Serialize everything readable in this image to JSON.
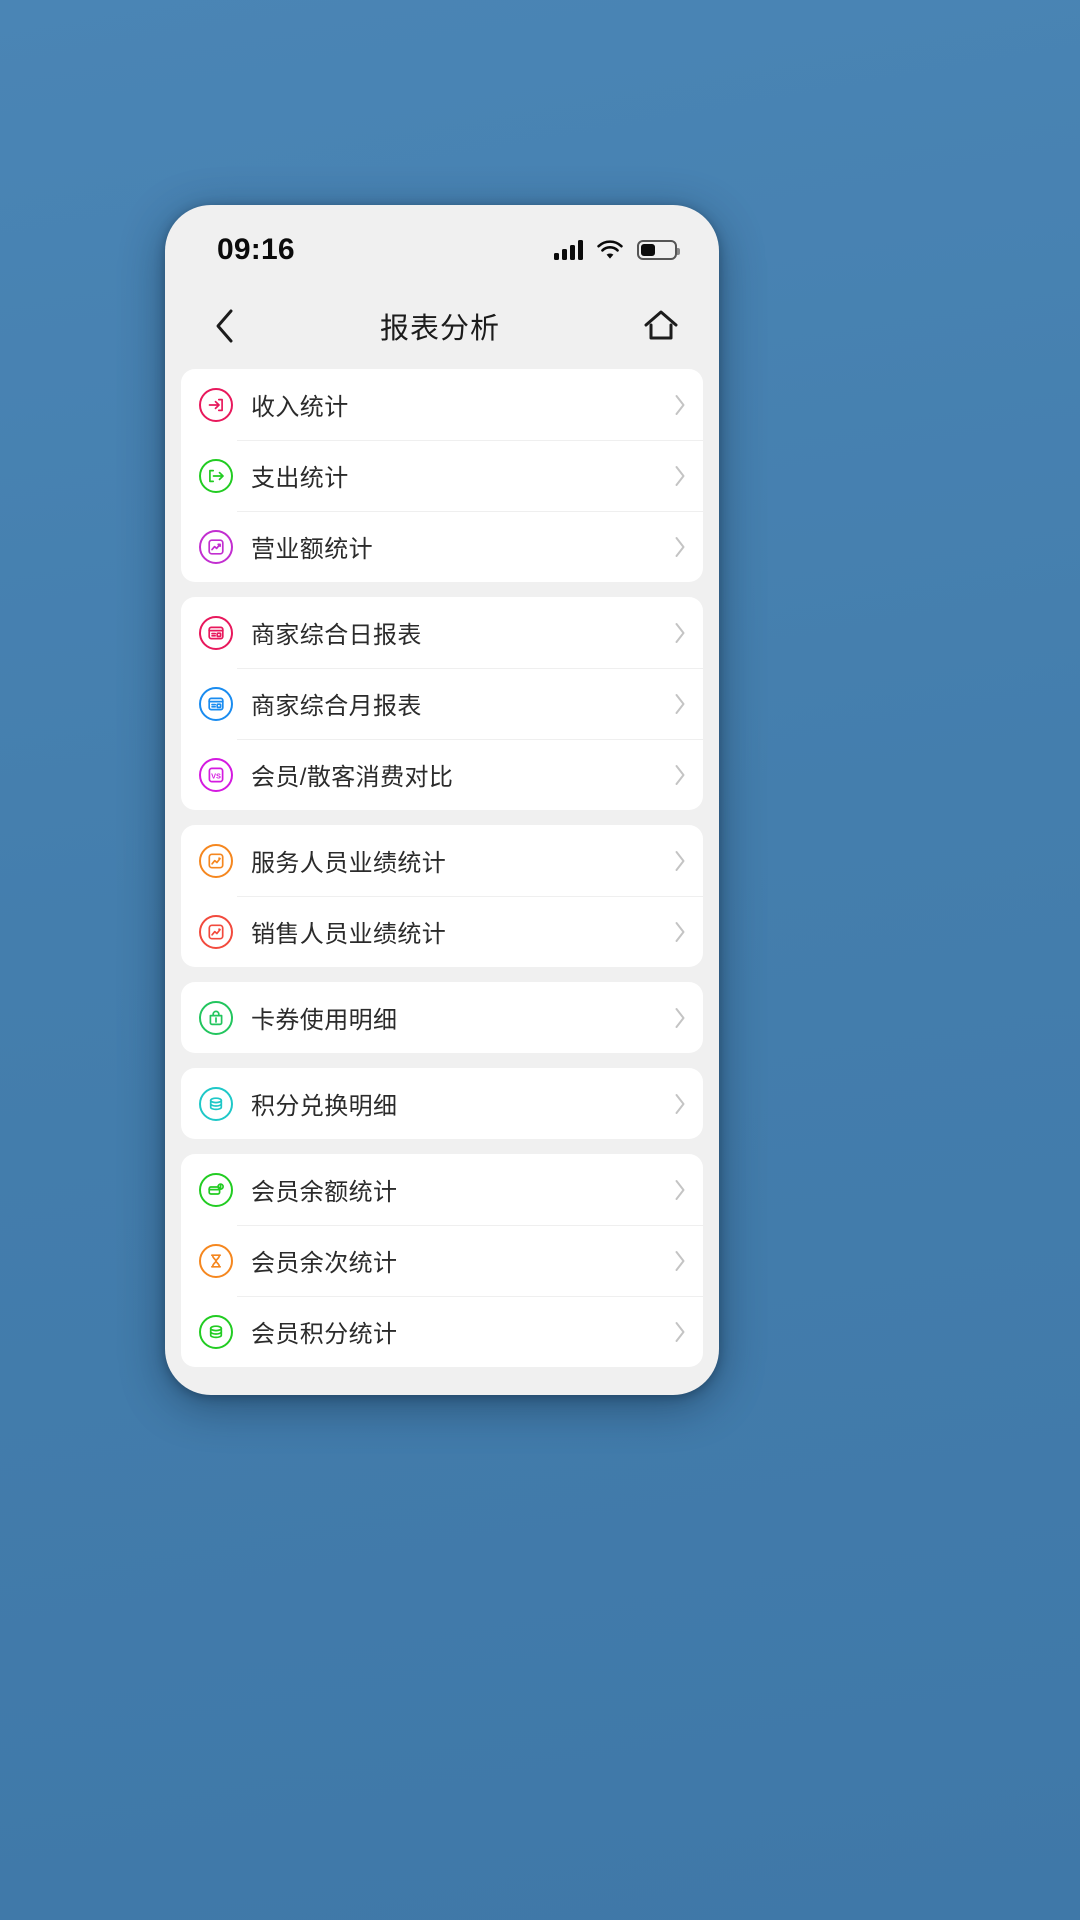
{
  "status_bar": {
    "time": "09:16",
    "signal_icon": "signal-bars-icon",
    "wifi_icon": "wifi-icon",
    "battery_icon": "battery-icon",
    "battery_level_percent": 45
  },
  "nav": {
    "back_icon": "chevron-left-icon",
    "title": "报表分析",
    "home_icon": "home-icon"
  },
  "theme": {
    "page_background": "#4a85b5",
    "phone_background": "#f0f0f0",
    "card_background": "#ffffff",
    "text_color": "#2b2b2b",
    "chevron_color": "#c4c4c4"
  },
  "groups": [
    {
      "items": [
        {
          "label": "收入统计",
          "icon": "income-arrow-in-icon",
          "color": "#e8185c",
          "chevron": "chevron-right-icon"
        },
        {
          "label": "支出统计",
          "icon": "expense-arrow-out-icon",
          "color": "#22cc22",
          "chevron": "chevron-right-icon"
        },
        {
          "label": "营业额统计",
          "icon": "trending-chart-icon",
          "color": "#c22ed0",
          "chevron": "chevron-right-icon"
        }
      ]
    },
    {
      "items": [
        {
          "label": "商家综合日报表",
          "icon": "daily-report-icon",
          "color": "#e8185c",
          "chevron": "chevron-right-icon"
        },
        {
          "label": "商家综合月报表",
          "icon": "monthly-report-icon",
          "color": "#1a8cf0",
          "chevron": "chevron-right-icon"
        },
        {
          "label": "会员/散客消费对比",
          "icon": "vs-compare-icon",
          "color": "#d41ae0",
          "chevron": "chevron-right-icon"
        }
      ]
    },
    {
      "items": [
        {
          "label": "服务人员业绩统计",
          "icon": "performance-chart-icon",
          "color": "#f5871f",
          "chevron": "chevron-right-icon"
        },
        {
          "label": "销售人员业绩统计",
          "icon": "performance-chart-icon",
          "color": "#f24a3d",
          "chevron": "chevron-right-icon"
        }
      ]
    },
    {
      "items": [
        {
          "label": "卡券使用明细",
          "icon": "gift-bag-icon",
          "color": "#22c55e",
          "chevron": "chevron-right-icon"
        }
      ]
    },
    {
      "items": [
        {
          "label": "积分兑换明细",
          "icon": "coins-stack-icon",
          "color": "#1fc8c8",
          "chevron": "chevron-right-icon"
        }
      ]
    },
    {
      "items": [
        {
          "label": "会员余额统计",
          "icon": "balance-card-icon",
          "color": "#22cc22",
          "chevron": "chevron-right-icon"
        },
        {
          "label": "会员余次统计",
          "icon": "hourglass-icon",
          "color": "#f5871f",
          "chevron": "chevron-right-icon"
        },
        {
          "label": "会员积分统计",
          "icon": "points-stack-icon",
          "color": "#22cc22",
          "chevron": "chevron-right-icon"
        }
      ]
    }
  ]
}
